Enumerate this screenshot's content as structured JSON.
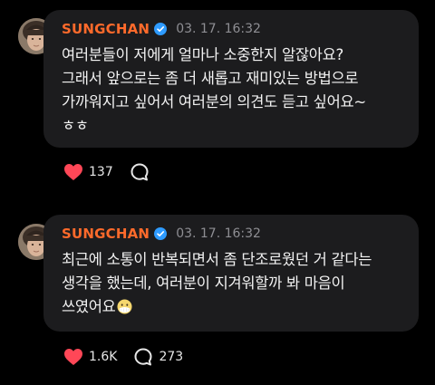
{
  "posts": [
    {
      "author": "SUNGCHAN",
      "timestamp": "03. 17. 16:32",
      "text": "여러분들이 저에게 얼마나 소중한지 알잖아요?\n그래서 앞으로는 좀 더 새롭고 재미있는 방법으로\n가까워지고 싶어서 여러분의 의견도 듣고 싶어요~\nㅎㅎ",
      "emoji": "",
      "likes": "137",
      "comments": ""
    },
    {
      "author": "SUNGCHAN",
      "timestamp": "03. 17. 16:32",
      "text": "최근에 소통이 반복되면서 좀 단조로웠던 거 같다는\n생각을 했는데, 여러분이 지겨워할까 봐 마음이\n쓰였어요",
      "emoji": "face-with-mouth-covered",
      "likes": "1.6K",
      "comments": "273"
    }
  ],
  "colors": {
    "background": "#000000",
    "bubble": "#1c1c1e",
    "author": "#ff6a2b",
    "verified": "#2e9bff",
    "heart": "#ff4757",
    "timestamp": "#8e8e93"
  },
  "icons": {
    "verified": "verified-badge-icon",
    "like": "heart-icon",
    "comment": "comment-bubble-icon"
  }
}
